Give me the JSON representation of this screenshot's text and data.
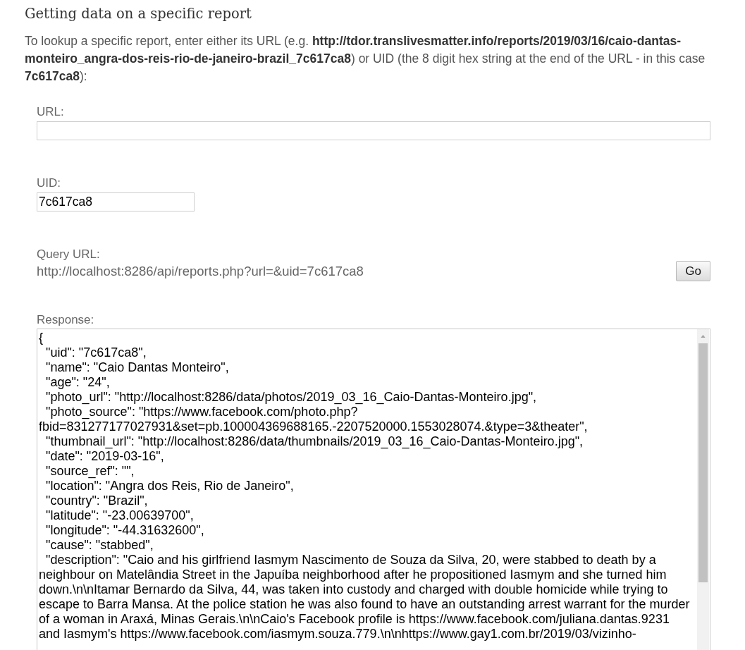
{
  "heading": "Getting data on a specific report",
  "intro": "To lookup a specific report, enter either its URL (e.g. **http://tdor.translivesmatter.info/reports/2019/03/16/caio-dantas-monteiro_angra-dos-reis-rio-de-janeiro-brazil_7c617ca8**) or UID (the 8 digit hex string at the end of the URL - in this case **7c617ca8**):",
  "form": {
    "url_field": {
      "label": "URL:"
    },
    "uid_field": {
      "label": "UID:",
      "value": "7c617ca8"
    },
    "query_url": {
      "label": "Query URL:",
      "value": "http://localhost:8286/api/reports.php?url=&uid=7c617ca8"
    },
    "go_button": "Go",
    "response": {
      "label": "Response:",
      "value": "{\n  \"uid\": \"7c617ca8\",\n  \"name\": \"Caio Dantas Monteiro\",\n  \"age\": \"24\",\n  \"photo_url\": \"http://localhost:8286/data/photos/2019_03_16_Caio-Dantas-Monteiro.jpg\",\n  \"photo_source\": \"https://www.facebook.com/photo.php?fbid=831277177027931&set=pb.100004369688165.-2207520000.1553028074.&type=3&theater\",\n  \"thumbnail_url\": \"http://localhost:8286/data/thumbnails/2019_03_16_Caio-Dantas-Monteiro.jpg\",\n  \"date\": \"2019-03-16\",\n  \"source_ref\": \"\",\n  \"location\": \"Angra dos Reis, Rio de Janeiro\",\n  \"country\": \"Brazil\",\n  \"latitude\": \"-23.00639700\",\n  \"longitude\": \"-44.31632600\",\n  \"cause\": \"stabbed\",\n  \"description\": \"Caio and his girlfriend Iasmym Nascimento de Souza da Silva, 20, were stabbed to death by a neighbour on Matelândia Street in the Japuíba neighborhood after he propositioned Iasmym and she turned him down.\\n\\nItamar Bernardo da Silva, 44, was taken into custody and charged with double homicide while trying to escape to Barra Mansa. At the police station he was also found to have an outstanding arrest warrant for the murder of a woman in Araxá, Minas Gerais.\\n\\nCaio's Facebook profile is https://www.facebook.com/juliana.dantas.9231 and Iasmym's https://www.facebook.com/iasmym.souza.779.\\n\\nhttps://www.gay1.com.br/2019/03/vizinho-"
    }
  }
}
